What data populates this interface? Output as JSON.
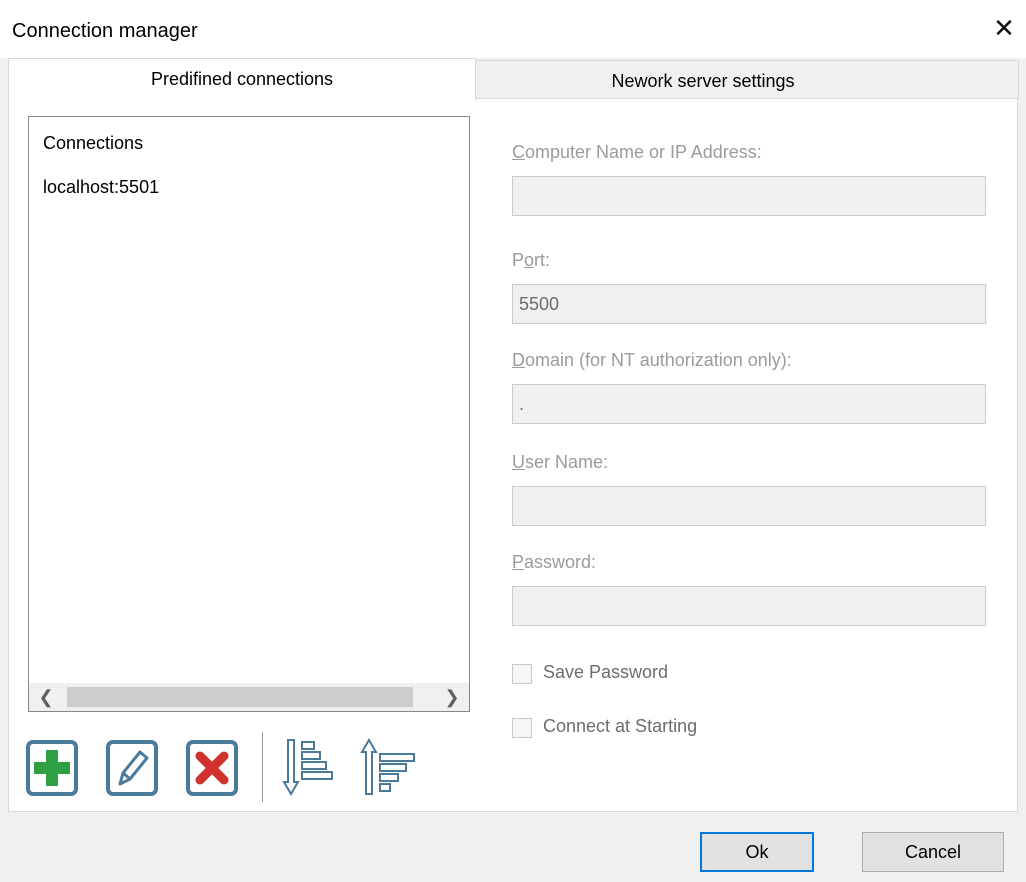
{
  "window": {
    "title": "Connection manager",
    "close_glyph": "✕"
  },
  "tabs": [
    {
      "label": "Predifined connections",
      "active": true
    },
    {
      "label": "Nework server settings",
      "active": false
    }
  ],
  "connections_list": {
    "items": [
      "Connections",
      "localhost:5501"
    ],
    "scroll_left_glyph": "❮",
    "scroll_right_glyph": "❯"
  },
  "toolbar": {
    "icons": [
      "add-icon",
      "edit-icon",
      "delete-icon",
      "move-down-icon",
      "move-up-icon"
    ],
    "colors": {
      "add": "#2ea043",
      "delete": "#d0312d",
      "frame": "#4a7a9a"
    }
  },
  "settings": {
    "computer_name": {
      "label_mnemonic": "C",
      "label_rest": "omputer Name or IP Address:",
      "value": ""
    },
    "port": {
      "label_prefix": "P",
      "label_mnemonic": "o",
      "label_rest": "rt:",
      "value": "5500"
    },
    "domain": {
      "label_mnemonic": "D",
      "label_rest": "omain (for NT authorization only):",
      "value": "."
    },
    "user_name": {
      "label_mnemonic": "U",
      "label_rest": "ser Name:",
      "value": ""
    },
    "password": {
      "label_mnemonic": "P",
      "label_rest": "assword:",
      "value": ""
    },
    "save_password": {
      "label": "Save Password",
      "checked": false
    },
    "connect_at_starting": {
      "label": "Connect at Starting",
      "checked": false
    }
  },
  "buttons": {
    "ok": "Ok",
    "cancel": "Cancel"
  }
}
